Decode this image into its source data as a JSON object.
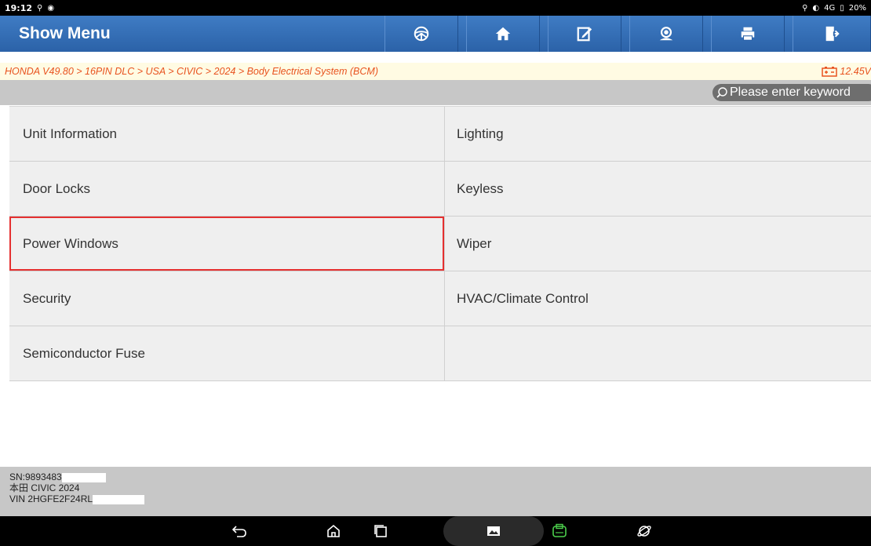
{
  "status": {
    "time": "19:12",
    "right_text": "4G",
    "battery": "20%"
  },
  "toolbar": {
    "title": "Show Menu",
    "buttons": [
      "steering-wheel-icon",
      "home-icon",
      "edit-icon",
      "support-icon",
      "print-icon",
      "exit-icon"
    ]
  },
  "breadcrumb": {
    "path": "HONDA V49.80 > 16PIN DLC > USA > CIVIC > 2024 > Body Electrical System (BCM)",
    "voltage": "12.45V"
  },
  "search": {
    "placeholder": "Please enter keyword"
  },
  "menu": {
    "rows": [
      [
        "Unit Information",
        "Lighting"
      ],
      [
        "Door Locks",
        "Keyless"
      ],
      [
        "Power Windows",
        "Wiper"
      ],
      [
        "Security",
        "HVAC/Climate Control"
      ],
      [
        "Semiconductor Fuse",
        ""
      ]
    ],
    "highlighted": "Power Windows"
  },
  "info": {
    "sn": "SN:9893483",
    "model": "本田 CIVIC 2024",
    "vin": "VIN 2HGFE2F24RL"
  },
  "colors": {
    "toolbar": "#2b62a8",
    "breadcrumb_text": "#e8531f",
    "highlight": "#e53030"
  }
}
